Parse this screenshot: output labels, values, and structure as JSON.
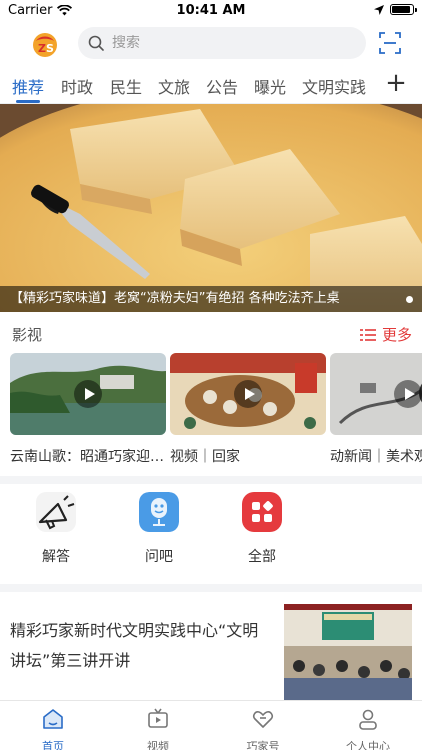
{
  "status_bar": {
    "carrier": "Carrier",
    "time": "10:41 AM",
    "battery_level": 0.9
  },
  "header": {
    "logo_icon": "app-logo-icon",
    "search_placeholder": "搜索",
    "search_icon": "search-icon",
    "scan_icon": "scan-icon"
  },
  "tabs": {
    "items": [
      {
        "label": "推荐",
        "active": true
      },
      {
        "label": "时政",
        "active": false
      },
      {
        "label": "民生",
        "active": false
      },
      {
        "label": "文旅",
        "active": false
      },
      {
        "label": "公告",
        "active": false
      },
      {
        "label": "曝光",
        "active": false
      },
      {
        "label": "文明实践",
        "active": false
      }
    ],
    "add_icon": "plus-icon",
    "active_color": "#2a6cc7"
  },
  "banner": {
    "caption": "【精彩巧家味道】老窝“凉粉夫妇”有绝招 各种吃法齐上桌"
  },
  "video_section": {
    "title": "影视",
    "more_label": "更多",
    "more_color": "#e23a3a",
    "videos": [
      {
        "title": "云南山歌：昭通巧家迎新年"
      },
      {
        "title": "视频｜回家"
      },
      {
        "title": "动新闻｜美术观"
      }
    ]
  },
  "quick_entries": [
    {
      "label": "解答",
      "icon": "megaphone-icon"
    },
    {
      "label": "问吧",
      "icon": "microphone-icon"
    },
    {
      "label": "全部",
      "icon": "grid-icon"
    }
  ],
  "news": [
    {
      "title": "精彩巧家新时代文明实践中心“文明讲坛”第三讲开讲"
    }
  ],
  "tabbar": [
    {
      "label": "首页",
      "icon": "home-icon",
      "active": true
    },
    {
      "label": "视频",
      "icon": "tv-icon",
      "active": false
    },
    {
      "label": "巧家号",
      "icon": "heart-icon",
      "active": false
    },
    {
      "label": "个人中心",
      "icon": "user-icon",
      "active": false
    }
  ]
}
